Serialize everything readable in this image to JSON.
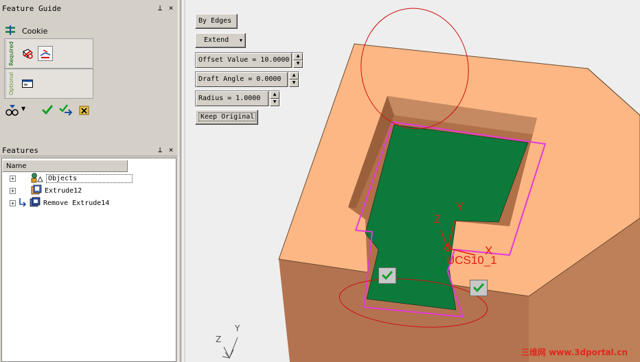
{
  "feature_guide": {
    "title": "Feature Guide",
    "feature_name": "Cookie",
    "required_label": "Required",
    "optional_label": "Optional"
  },
  "features": {
    "title": "Features",
    "column_header": "Name",
    "items": [
      {
        "label": "Objects"
      },
      {
        "label": "Extrude12"
      },
      {
        "label": "Remove Extrude14"
      }
    ]
  },
  "pin_glyph": "⊥",
  "close_glyph": "×",
  "viewport": {
    "by_edges_label": "By Edges",
    "extend_label": "Extend",
    "offset_field": "Offset Value = 10.0000",
    "draft_field": "Draft Angle =  0.0000",
    "radius_field": "Radius =  1.0000",
    "keep_original_label": "Keep Original",
    "ucs_name": "UCS10_1",
    "axis_x": "X",
    "axis_y": "Y",
    "axis_z": "Z",
    "triad_y": "Y",
    "triad_z": "Z",
    "watermark": "三维网 www.3dportal.cn"
  },
  "colors": {
    "block_top": "#fdb784",
    "block_side": "#bd8058",
    "block_front": "#b37350",
    "green_face": "#0c7a3a",
    "preview_outline": "#e23ad9",
    "annotation_red": "#cc1010"
  }
}
